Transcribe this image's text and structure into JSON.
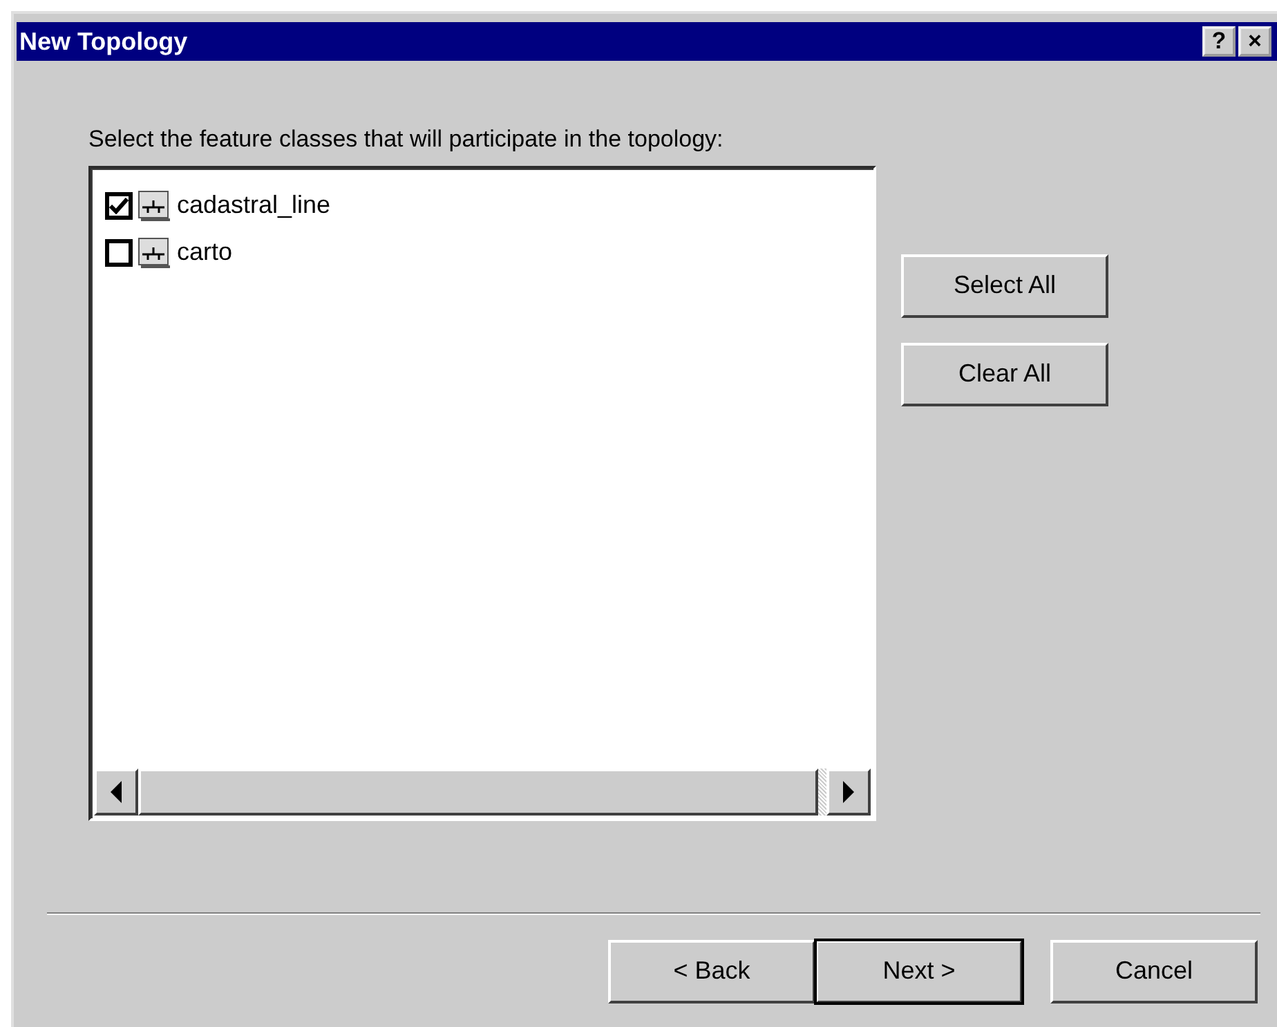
{
  "window": {
    "title": "New Topology",
    "title_buttons": [
      "?",
      "×"
    ]
  },
  "prompt": "Select the feature classes that will participate in the topology:",
  "feature_classes": [
    {
      "label": "cadastral_line",
      "checked": true
    },
    {
      "label": "carto",
      "checked": false
    }
  ],
  "side_buttons": [
    "Select All",
    "Clear All"
  ],
  "footer_buttons": [
    {
      "label": "< Back",
      "default": false
    },
    {
      "label": "Next >",
      "default": true
    },
    {
      "label": "Cancel",
      "default": false
    }
  ]
}
